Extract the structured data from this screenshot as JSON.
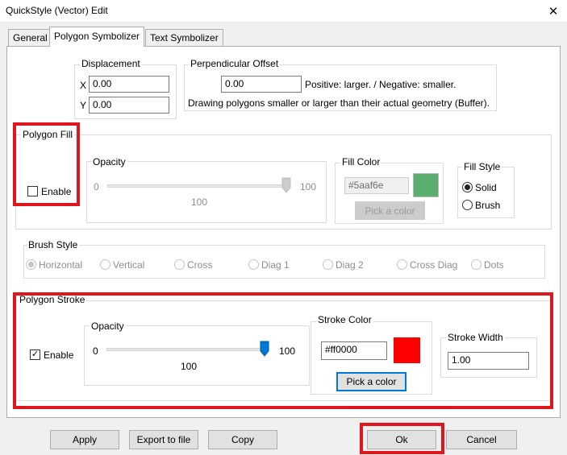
{
  "window": {
    "title": "QuickStyle (Vector) Edit",
    "close_glyph": "✕"
  },
  "tabs": [
    {
      "label": "General"
    },
    {
      "label": "Polygon Symbolizer"
    },
    {
      "label": "Text Symbolizer"
    }
  ],
  "displacement": {
    "label": "Displacement",
    "x_label": "X",
    "x_value": "0.00",
    "y_label": "Y",
    "y_value": "0.00"
  },
  "offset": {
    "label": "Perpendicular Offset",
    "value": "0.00",
    "hint": "Positive: larger. / Negative: smaller.",
    "description": "Drawing polygons smaller or larger than their actual geometry (Buffer)."
  },
  "fill": {
    "label": "Polygon Fill",
    "enable_label": "Enable",
    "enabled": false,
    "opacity": {
      "label": "Opacity",
      "min": "0",
      "max": "100",
      "value": "100"
    },
    "color": {
      "label": "Fill Color",
      "value": "#5aaf6e",
      "swatch": "#5aaf6e",
      "pick_label": "Pick a color"
    },
    "style": {
      "label": "Fill Style",
      "options": [
        {
          "label": "Solid",
          "selected": true
        },
        {
          "label": "Brush",
          "selected": false
        }
      ]
    }
  },
  "brush": {
    "label": "Brush Style",
    "options": [
      {
        "label": "Horizontal",
        "selected": true
      },
      {
        "label": "Vertical",
        "selected": false
      },
      {
        "label": "Cross",
        "selected": false
      },
      {
        "label": "Diag 1",
        "selected": false
      },
      {
        "label": "Diag 2",
        "selected": false
      },
      {
        "label": "Cross Diag",
        "selected": false
      },
      {
        "label": "Dots",
        "selected": false
      }
    ]
  },
  "stroke": {
    "label": "Polygon Stroke",
    "enable_label": "Enable",
    "enabled": true,
    "check_glyph": "✓",
    "opacity": {
      "label": "Opacity",
      "min": "0",
      "max": "100",
      "value": "100"
    },
    "color": {
      "label": "Stroke Color",
      "value": "#ff0000",
      "swatch": "#ff0000",
      "pick_label": "Pick a color"
    },
    "width": {
      "label": "Stroke Width",
      "value": "1.00"
    }
  },
  "footer": {
    "apply": "Apply",
    "export": "Export to file",
    "copy": "Copy",
    "ok": "Ok",
    "cancel": "Cancel"
  },
  "accent_color": "#0078d7",
  "highlight_color": "#e0161e"
}
